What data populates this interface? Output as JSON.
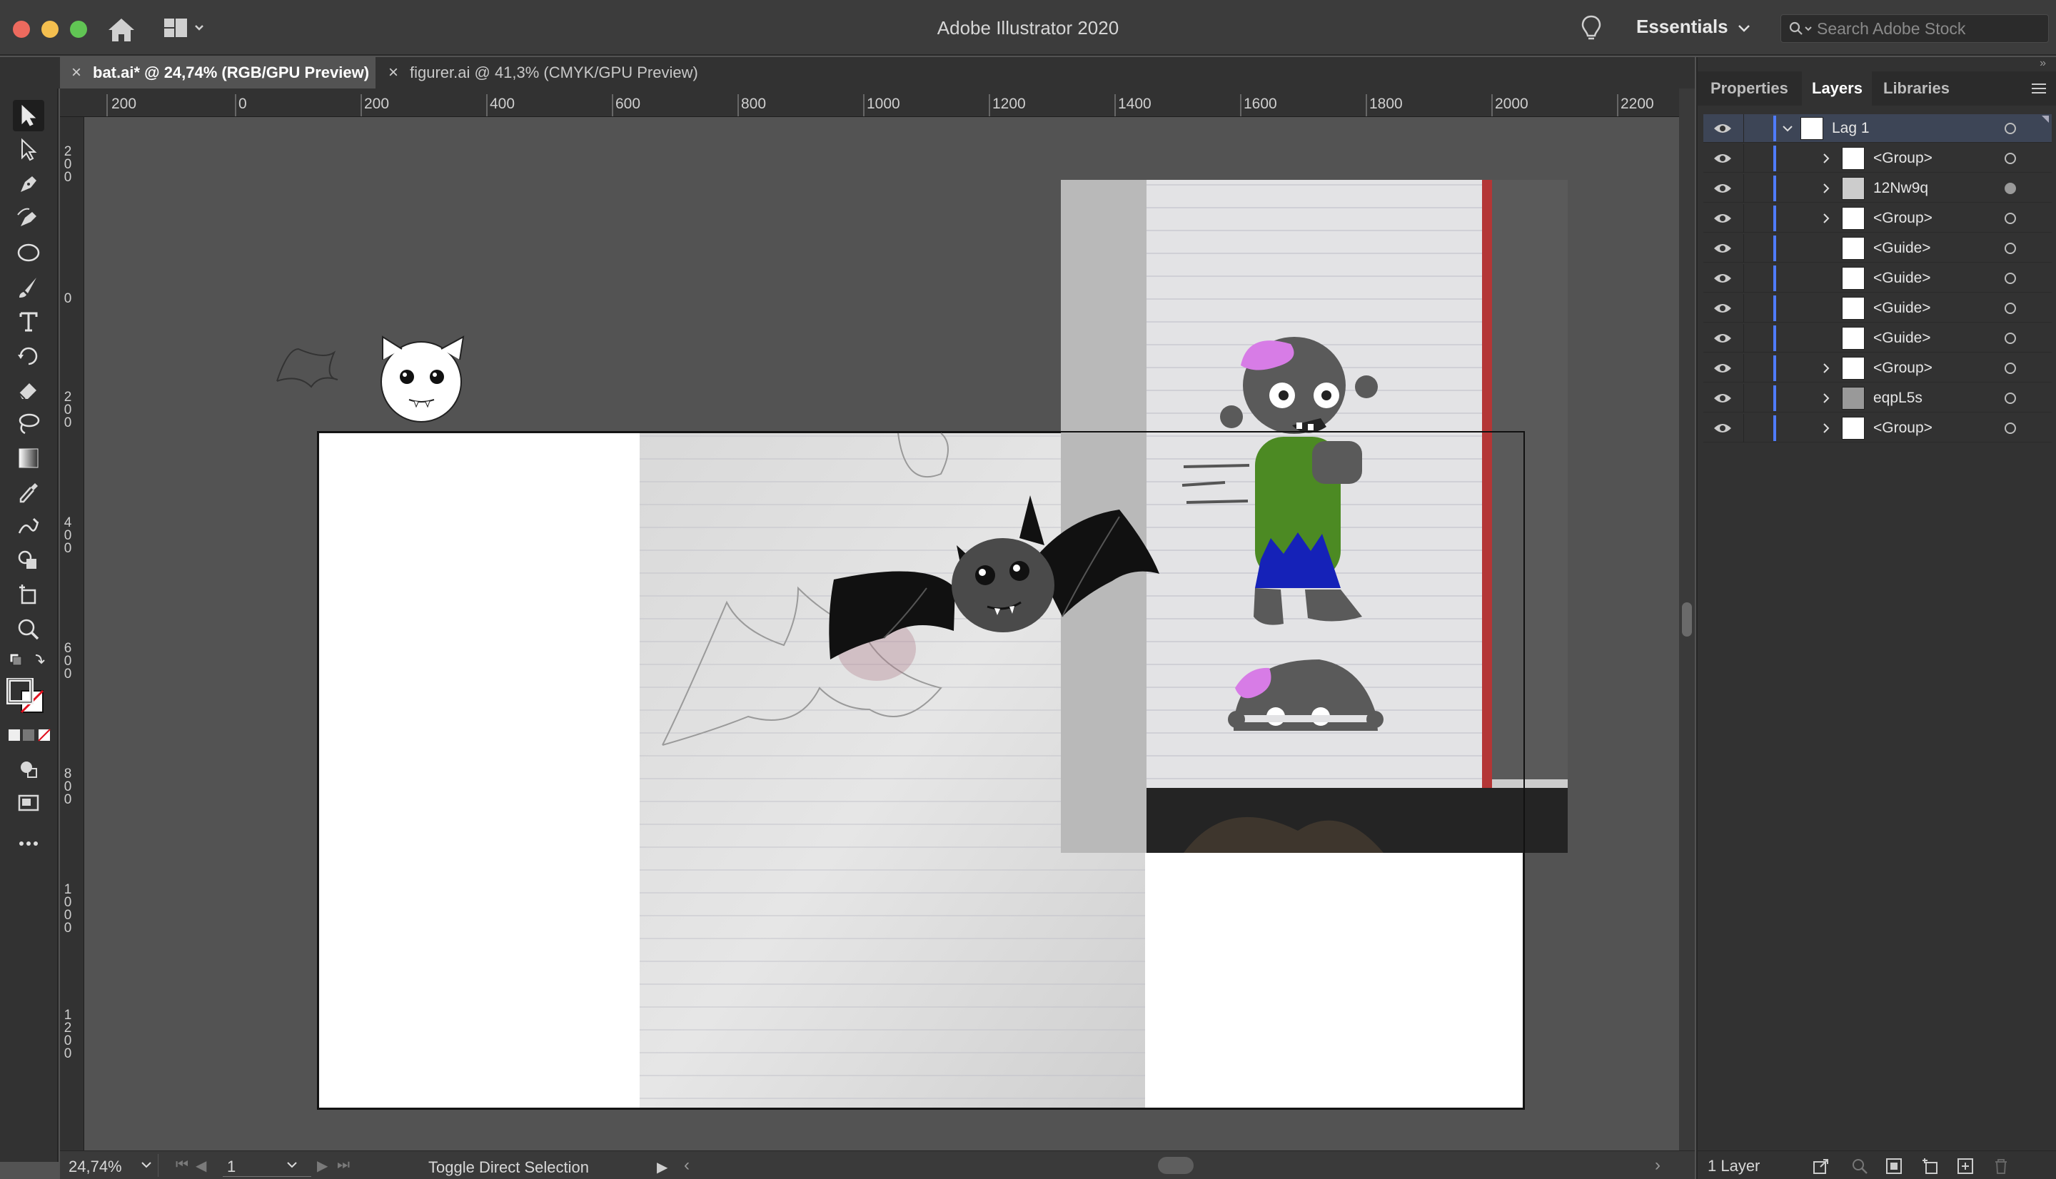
{
  "window": {
    "title": "Adobe Illustrator 2020",
    "workspace": "Essentials",
    "stock_search_placeholder": "Search Adobe Stock"
  },
  "tabs": [
    {
      "label": "bat.ai* @ 24,74% (RGB/GPU Preview)",
      "active": true,
      "close": "×"
    },
    {
      "label": "figurer.ai @ 41,3% (CMYK/GPU Preview)",
      "active": false,
      "close": "×"
    }
  ],
  "ruler": {
    "horizontal": [
      "200",
      "0",
      "200",
      "400",
      "600",
      "800",
      "1000",
      "1200",
      "1400",
      "1600",
      "1800",
      "2000",
      "2200"
    ],
    "vertical": [
      "200",
      "0",
      "200",
      "400",
      "600",
      "800",
      "1000",
      "1200"
    ]
  },
  "tools": [
    "selection-tool",
    "direct-selection-tool",
    "pen-tool",
    "curvature-tool",
    "ellipse-tool",
    "paintbrush-tool",
    "type-tool",
    "rotate-tool",
    "eraser-tool",
    "lasso-tool",
    "gradient-tool",
    "eyedropper-tool",
    "shaper-tool",
    "shape-builder-tool",
    "artboard-tool",
    "zoom-tool",
    "fill-stroke",
    "draw-mode",
    "screen-mode",
    "more-tools"
  ],
  "status": {
    "zoom": "24,74%",
    "page": "1",
    "text": "Toggle Direct Selection"
  },
  "panel": {
    "tabs": [
      "Properties",
      "Layers",
      "Libraries"
    ],
    "active_tab": "Layers",
    "layer_count": "1 Layer",
    "layers": [
      {
        "name": "Lag 1",
        "expanded": true,
        "top": true
      },
      {
        "name": "<Group>",
        "expandable": true
      },
      {
        "name": "12Nw9q",
        "expandable": true,
        "target_filled": true
      },
      {
        "name": "<Group>",
        "expandable": true
      },
      {
        "name": "<Guide>",
        "expandable": false
      },
      {
        "name": "<Guide>",
        "expandable": false
      },
      {
        "name": "<Guide>",
        "expandable": false
      },
      {
        "name": "<Guide>",
        "expandable": false
      },
      {
        "name": "<Group>",
        "expandable": true
      },
      {
        "name": "eqpL5s",
        "expandable": true
      },
      {
        "name": "<Group>",
        "expandable": true
      }
    ]
  },
  "colors": {
    "accent_layer": "#4f7cff",
    "zombie_skin": "#5a5a5a",
    "zombie_brain": "#d77ce6",
    "zombie_shirt": "#4c8a23",
    "zombie_pants": "#1522b8"
  }
}
